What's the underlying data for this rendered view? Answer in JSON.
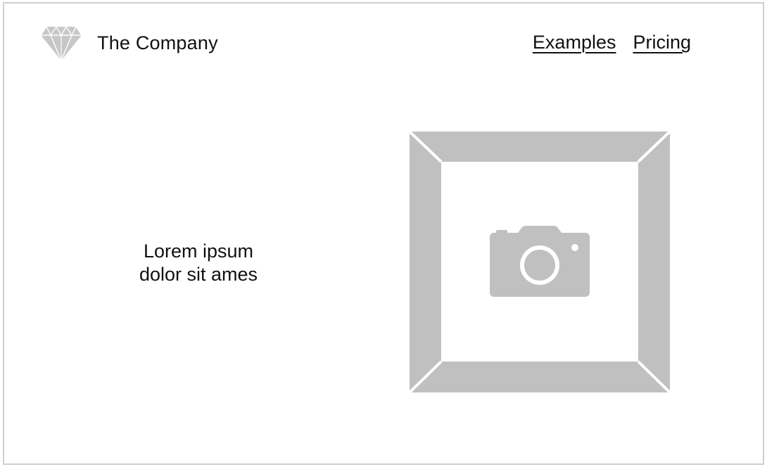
{
  "header": {
    "company_name": "The Company",
    "logo_icon": "diamond-icon",
    "nav": [
      {
        "label": "Examples"
      },
      {
        "label": "Pricing"
      }
    ]
  },
  "hero": {
    "text_line_1": "Lorem ipsum",
    "text_line_2": "dolor sit ames",
    "image_icon": "camera-icon"
  },
  "colors": {
    "placeholder_gray": "#c0c0c0",
    "border_gray": "#cfcfcf",
    "text": "#111111",
    "background": "#ffffff"
  }
}
